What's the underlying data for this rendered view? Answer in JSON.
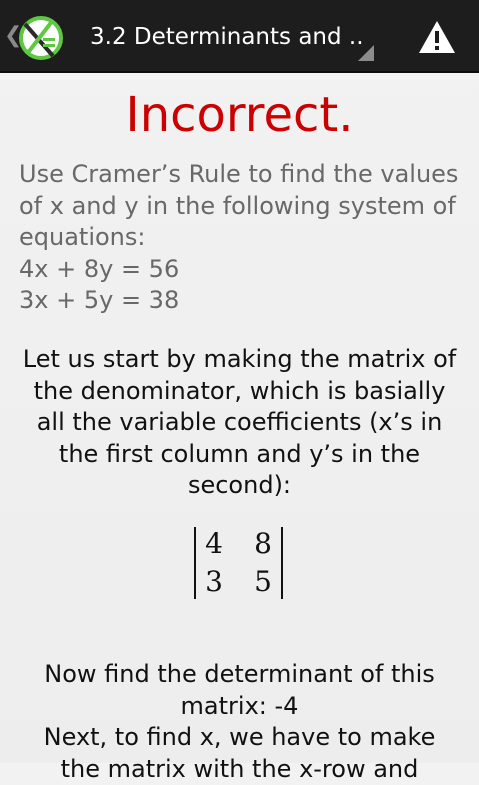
{
  "actionbar": {
    "title": "3.2 Determinants and ..",
    "up_caret": "❮"
  },
  "result": "Incorrect.",
  "problem": {
    "lines": [
      "Use Cramer’s Rule to find the values",
      "of x and y in the following system of",
      "equations:",
      "4x + 8y = 56",
      "3x + 5y = 38"
    ]
  },
  "explanation": {
    "lines": [
      "Let us start by making the matrix of",
      "the denominator, which is basially",
      "all the variable coefficients (x’s in",
      "the first column and y’s in the",
      "second):"
    ]
  },
  "matrix": {
    "rows": [
      [
        "4",
        "8"
      ],
      [
        "3",
        "5"
      ]
    ]
  },
  "explanation2": {
    "lines": [
      "Now find the determinant of this",
      "matrix: -4",
      "Next, to find x, we have to make",
      "the matrix with the x-row and"
    ]
  },
  "colors": {
    "result": "#cc0000",
    "problem_text": "#686868",
    "actionbar": "#1d1d1d"
  },
  "icons": {
    "logo": "app-logo-icon",
    "spinner": "spinner-triangle-icon",
    "warning": "warning-icon"
  }
}
